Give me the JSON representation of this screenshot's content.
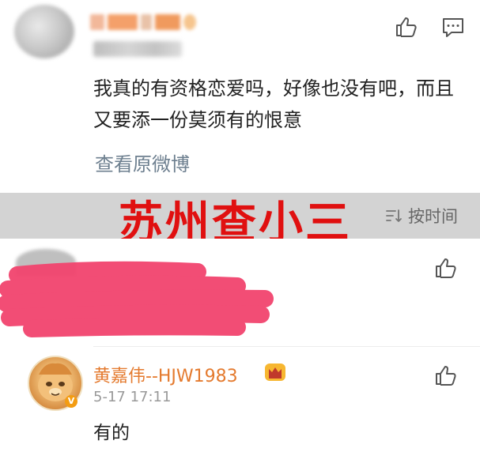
{
  "comment1": {
    "text": "我真的有资格恋爱吗，好像也没有吧，而且又要添一份莫须有的恨意",
    "view_original": "查看原微博",
    "like_icon": "thumbs-up-icon",
    "reply_icon": "comment-icon"
  },
  "sort_bar": {
    "label": "按时间",
    "icon": "sort-icon"
  },
  "watermark": "苏州查小三",
  "comment2": {
    "like_icon": "thumbs-up-icon"
  },
  "comment3": {
    "username": "黄嘉伟--HJW1983",
    "time": "5-17 17:11",
    "text": "有的",
    "verified_badge": "V",
    "crown_icon": "crown-icon",
    "like_icon": "thumbs-up-icon"
  },
  "colors": {
    "username": "#e47a2e",
    "link": "#6d7f8f",
    "watermark": "#e01010",
    "scribble": "#f2446e"
  }
}
